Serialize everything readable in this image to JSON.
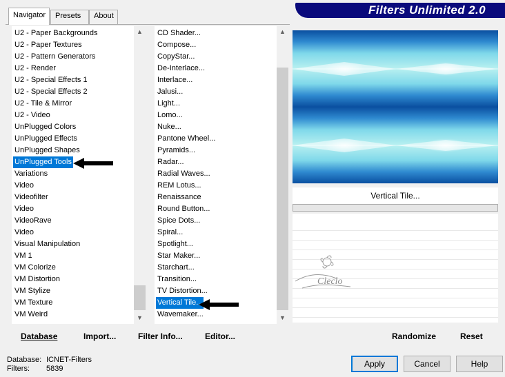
{
  "tabs": [
    "Navigator",
    "Presets",
    "About"
  ],
  "banner_title": "Filters Unlimited 2.0",
  "categories": [
    "U2 - Paper Backgrounds",
    "U2 - Paper Textures",
    "U2 - Pattern Generators",
    "U2 - Render",
    "U2 - Special Effects 1",
    "U2 - Special Effects 2",
    "U2 - Tile & Mirror",
    "U2 - Video",
    "UnPlugged Colors",
    "UnPlugged Effects",
    "UnPlugged Shapes",
    "UnPlugged Tools",
    "Variations",
    "Video",
    "Videofilter",
    "Video",
    "VideoRave",
    "Video",
    "Visual Manipulation",
    "VM 1",
    "VM Colorize",
    "VM Distortion",
    "VM Stylize",
    "VM Texture",
    "VM Weird"
  ],
  "selected_category": "UnPlugged Tools",
  "filters": [
    "CD Shader...",
    "Compose...",
    "CopyStar...",
    "De-Interlace...",
    "Interlace...",
    "Jalusi...",
    "Light...",
    "Lomo...",
    "Nuke...",
    "Pantone Wheel...",
    "Pyramids...",
    "Radar...",
    "Radial Waves...",
    "REM Lotus...",
    "Renaissance",
    "Round Button...",
    "Spice Dots...",
    "Spiral...",
    "Spotlight...",
    "Star Maker...",
    "Starchart...",
    "Transition...",
    "TV Distortion...",
    "Vertical Tile...",
    "Wavemaker..."
  ],
  "selected_filter": "Vertical Tile...",
  "current_filter_name": "Vertical Tile...",
  "toolbar": {
    "database": "Database",
    "import": "Import...",
    "filter_info": "Filter Info...",
    "editor": "Editor...",
    "randomize": "Randomize",
    "reset": "Reset"
  },
  "status": {
    "database_label": "Database:",
    "database_value": "ICNET-Filters",
    "filters_label": "Filters:",
    "filters_value": "5839"
  },
  "buttons": {
    "apply": "Apply",
    "cancel": "Cancel",
    "help": "Help"
  },
  "watermark_text": "Cleclo",
  "colors": {
    "selection": "#0078d7",
    "banner": "#0a0a7c",
    "preview_dark": "#1560b0",
    "preview_light": "#a8ecee"
  },
  "icons": [
    "arrow-pointer-icon",
    "scroll-up-icon",
    "scroll-down-icon"
  ]
}
